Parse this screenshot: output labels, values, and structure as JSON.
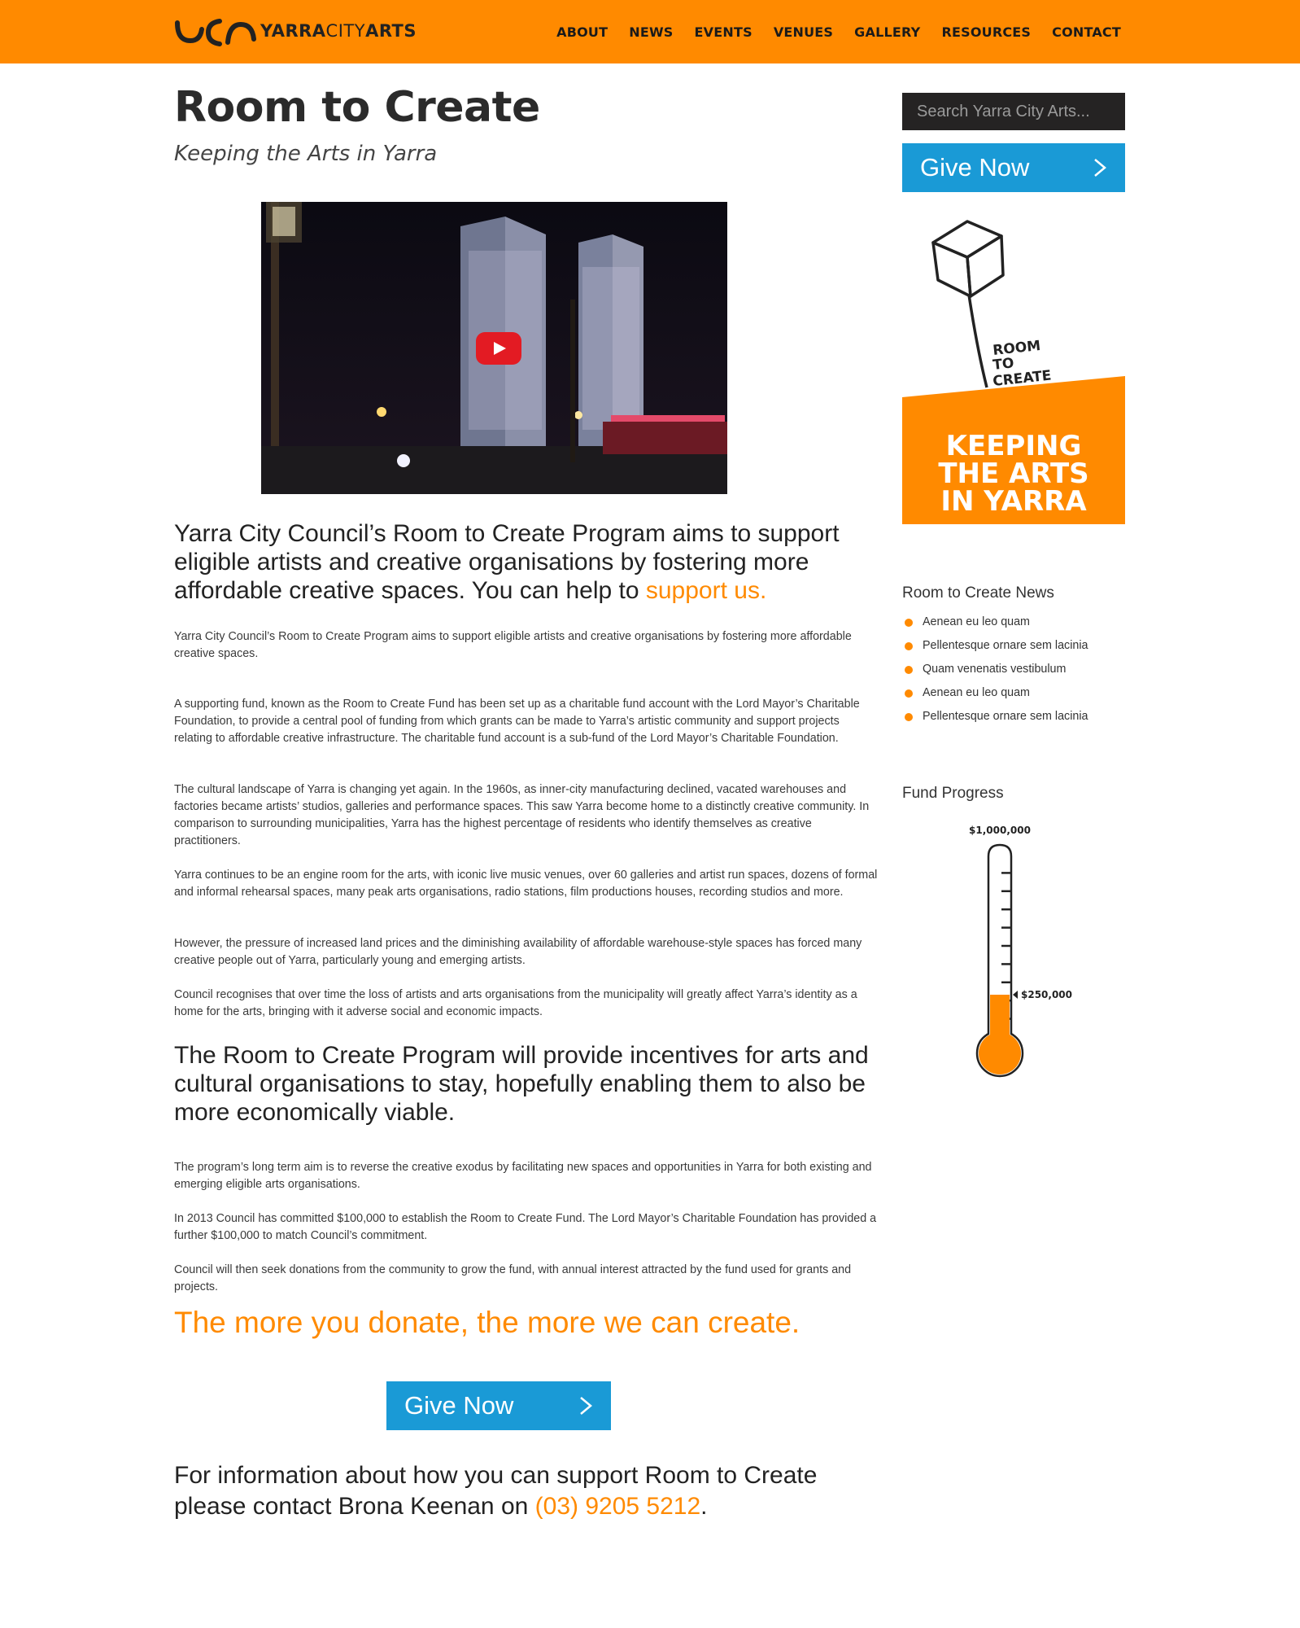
{
  "header": {
    "logo_bold": "YARRA",
    "logo_thin": "CITY",
    "logo_end": "ARTS",
    "nav": [
      "ABOUT",
      "NEWS",
      "EVENTS",
      "VENUES",
      "GALLERY",
      "RESOURCES",
      "CONTACT"
    ]
  },
  "main": {
    "title": "Room to Create",
    "subtitle": "Keeping the Arts in Yarra",
    "lead_1_text": "Yarra City Council’s Room to Create Program aims to support eligible artists and creative organisations by fostering more affordable creative spaces. You can help to ",
    "lead_1_link": "support us.",
    "paragraphs_1": [
      "Yarra City Council’s Room to Create Program aims to support eligible artists and creative organisations by fostering more affordable creative spaces.",
      "A supporting fund, known as the Room to Create Fund has been set up as a charitable fund account with the Lord Mayor’s Charitable Foundation, to provide a central pool of funding from which grants can be made to Yarra’s artistic community and support projects relating to affordable creative infrastructure. The charitable fund account is a sub-fund of the Lord Mayor’s Charitable Foundation.",
      "The cultural landscape of Yarra is changing yet again. In the 1960s, as inner-city manufacturing declined, vacated warehouses and factories became artists’ studios, galleries and performance spaces. This saw Yarra become home to a distinctly creative community.  In comparison to surrounding municipalities, Yarra has the highest percentage of residents who identify themselves as creative practitioners.",
      "Yarra continues to be an engine room for the arts, with iconic live music venues, over 60 galleries and artist run spaces, dozens of formal and informal rehearsal spaces, many peak arts organisations, radio stations, film productions houses, recording studios and more.",
      "However, the pressure of increased land prices and the diminishing availability of affordable warehouse-style spaces has forced many creative people out of Yarra, particularly young and emerging artists.",
      "Council recognises that over time the loss of artists and arts organisations from the municipality will greatly affect Yarra’s identity as a home for the arts, bringing with it adverse social and economic impacts."
    ],
    "lead_2": "The Room to Create Program will provide incentives for arts and cultural organisations to stay, hopefully enabling them to also be more economically viable.",
    "paragraphs_2": [
      "The program’s long term aim is to reverse the creative exodus by facilitating new spaces and opportunities in Yarra for both existing and emerging eligible arts organisations.",
      "In 2013 Council has committed $100,000 to establish the Room to Create Fund. The Lord Mayor’s Charitable Foundation has provided a further $100,000 to match Council’s commitment.",
      "Council will then seek donations from the community to grow the fund, with annual interest attracted by the fund used for grants and projects."
    ],
    "donate_line": "The more you donate, the more we can create.",
    "give_label": "Give Now",
    "contact_text": "For information about how you can support Room to Create please contact Brona Keenan on ",
    "contact_phone": "(03) 9205 5212",
    "contact_end": "."
  },
  "sidebar": {
    "search_placeholder": "Search Yarra City Arts...",
    "give_label": "Give Now",
    "graphic_sign": [
      "ROOM",
      "TO",
      "CREATE"
    ],
    "banner_lines": [
      "KEEPING",
      "THE ARTS",
      "IN YARRA"
    ],
    "news_heading": "Room to Create News",
    "news_items": [
      "Aenean eu leo quam",
      "Pellentesque ornare sem lacinia",
      "Quam venenatis vestibulum",
      "Aenean eu leo quam",
      "Pellentesque ornare sem lacinia"
    ],
    "fund_heading": "Fund Progress",
    "fund_target_label": "$1,000,000",
    "fund_current_label": "$250,000",
    "fund_progress": 0.25
  },
  "colors": {
    "brand_orange": "#ff8a00",
    "button_blue": "#1a9ad6",
    "search_bg": "#252323",
    "youtube_red": "#e31b23"
  },
  "icons": [
    "play-icon",
    "chevron-right-icon",
    "search-icon",
    "bullet-icon"
  ]
}
